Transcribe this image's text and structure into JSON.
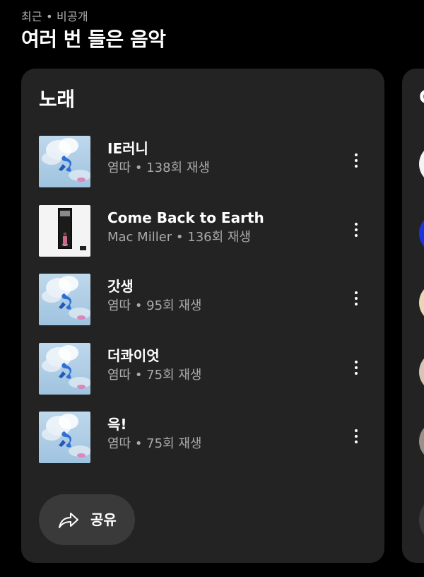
{
  "header": {
    "eyebrow": "최근 • 비공개",
    "title": "여러 번 들은 음악"
  },
  "songs_card": {
    "title": "노래",
    "songs": [
      {
        "title": "IE러니",
        "meta": "염따 • 138회 재생",
        "art": "blue-figure-cloud-art"
      },
      {
        "title": "Come Back to Earth",
        "meta": "Mac Miller • 136회 재생",
        "art": "dark-doorway-figure-art"
      },
      {
        "title": "갓생",
        "meta": "염따 • 95회 재생",
        "art": "blue-figure-cloud-art"
      },
      {
        "title": "더콰이엇",
        "meta": "염따 • 75회 재생",
        "art": "blue-figure-cloud-art"
      },
      {
        "title": "윽!",
        "meta": "염따 • 75회 재생",
        "art": "blue-figure-cloud-art"
      }
    ],
    "more_icon": "more-vertical-icon",
    "share": {
      "label": "공유",
      "icon": "share-arrow-icon"
    }
  },
  "next_card": {
    "title_fragment": "C"
  },
  "colors": {
    "background": "#000000",
    "card": "#232323",
    "button": "#3a3a3a",
    "secondary_text": "#aaaaaa"
  }
}
